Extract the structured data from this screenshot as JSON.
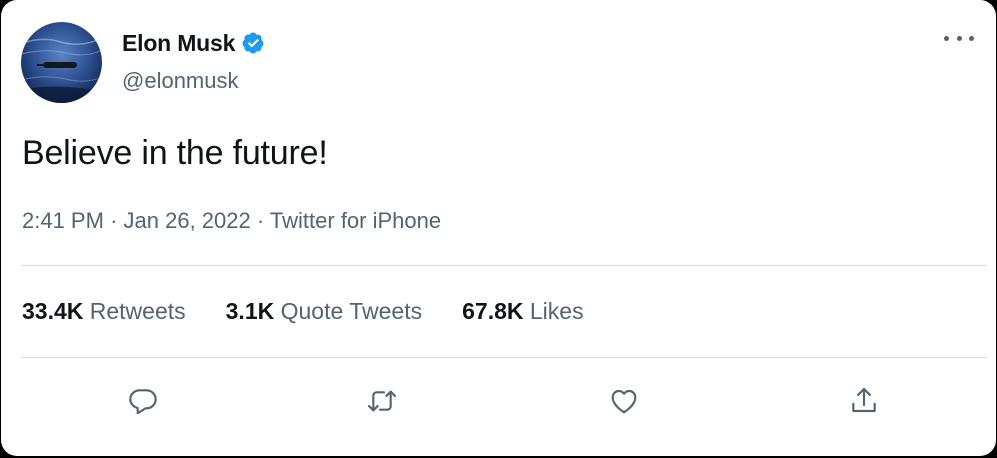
{
  "author": {
    "display_name": "Elon Musk",
    "handle": "@elonmusk",
    "verified": true,
    "verified_color": "#1d9bf0",
    "avatar_icon": "avatar-photo-icon"
  },
  "menu": {
    "icon": "more-options-icon"
  },
  "tweet": {
    "text": "Believe in the future!",
    "time": "2:41 PM",
    "separator": "·",
    "date": "Jan 26, 2022",
    "source": "Twitter for iPhone"
  },
  "stats": {
    "retweets": {
      "count": "33.4K",
      "label": "Retweets"
    },
    "quotes": {
      "count": "3.1K",
      "label": "Quote Tweets"
    },
    "likes": {
      "count": "67.8K",
      "label": "Likes"
    }
  },
  "actions": [
    {
      "name": "reply",
      "icon": "reply-icon"
    },
    {
      "name": "retweet",
      "icon": "retweet-icon"
    },
    {
      "name": "like",
      "icon": "heart-icon"
    },
    {
      "name": "share",
      "icon": "share-icon"
    }
  ],
  "colors": {
    "text_primary": "#0f1419",
    "text_secondary": "#536471",
    "divider": "#cfd9de",
    "icon": "#536471"
  }
}
